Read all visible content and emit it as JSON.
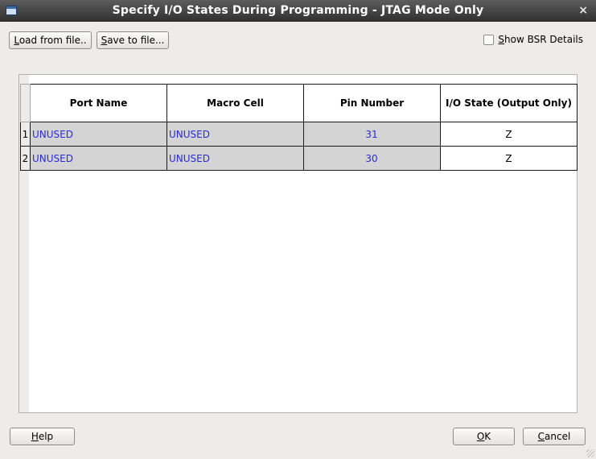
{
  "window": {
    "title": "Specify I/O States During Programming - JTAG Mode Only",
    "close_glyph": "×"
  },
  "toolbar": {
    "load_mnemonic": "L",
    "load_rest": "oad from file..",
    "save_mnemonic": "S",
    "save_rest": "ave to file...",
    "bsr_mnemonic": "S",
    "bsr_rest": "how BSR Details",
    "bsr_checked": false
  },
  "table": {
    "columns": [
      "Port Name",
      "Macro Cell",
      "Pin Number",
      "I/O State (Output Only)"
    ],
    "rows": [
      {
        "num": "1",
        "port": "UNUSED",
        "macro": "UNUSED",
        "pin": "31",
        "state": "Z"
      },
      {
        "num": "2",
        "port": "UNUSED",
        "macro": "UNUSED",
        "pin": "30",
        "state": "Z"
      }
    ]
  },
  "footer": {
    "help_mnemonic": "H",
    "help_rest": "elp",
    "ok_mnemonic": "O",
    "ok_rest": "K",
    "cancel_mnemonic": "C",
    "cancel_rest": "ancel"
  }
}
